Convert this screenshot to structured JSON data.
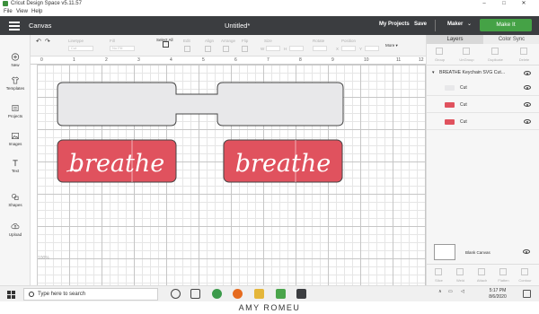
{
  "window": {
    "title": "Cricut Design Space  v5.11.57",
    "controls": [
      "–",
      "□",
      "✕"
    ]
  },
  "menu": [
    "File",
    "View",
    "Help"
  ],
  "header": {
    "section": "Canvas",
    "document_title": "Untitled*",
    "my_projects": "My Projects",
    "save": "Save",
    "machine": "Maker",
    "make_it": "Make It",
    "accent_color": "#45a246"
  },
  "toolbar": {
    "undo_icon": "undo-icon",
    "redo_icon": "redo-icon",
    "linetype_label": "Linetype",
    "linetype_value": "Cut",
    "fill_label": "Fill",
    "fill_value": "No Fill",
    "select_all": "Select All",
    "edit": "Edit",
    "align": "Align",
    "arrange": "Arrange",
    "flip": "Flip",
    "size": "Size",
    "rotate": "Rotate",
    "position": "Position",
    "more": "More ▾",
    "w_label": "W",
    "h_label": "H",
    "x_label": "X",
    "y_label": "Y"
  },
  "leftnav": [
    {
      "label": "New",
      "icon": "plus-icon"
    },
    {
      "label": "Templates",
      "icon": "shirt-icon"
    },
    {
      "label": "Projects",
      "icon": "folder-icon"
    },
    {
      "label": "Images",
      "icon": "image-icon"
    },
    {
      "label": "Text",
      "icon": "text-icon"
    },
    {
      "label": "Shapes",
      "icon": "shapes-icon"
    },
    {
      "label": "Upload",
      "icon": "upload-icon"
    }
  ],
  "ruler": [
    "0",
    "1",
    "2",
    "3",
    "4",
    "5",
    "6",
    "7",
    "8",
    "9",
    "10",
    "11",
    "12"
  ],
  "canvas": {
    "zoom": "100%",
    "design_text": [
      "breathe",
      "breathe"
    ],
    "keychain_color": "#e8e8ea",
    "red_color": "#e0525e"
  },
  "layers_panel": {
    "tabs": [
      "Layers",
      "Color Sync"
    ],
    "top_tools": [
      "Group",
      "UnGroup",
      "Duplicate",
      "Delete"
    ],
    "group_name": "BREATHE Keychain SVG Cut...",
    "layers": [
      {
        "name": "Cut",
        "swatch": "#e8e8ea"
      },
      {
        "name": "Cut",
        "swatch": "#e0525e"
      },
      {
        "name": "Cut",
        "swatch": "#e0525e"
      }
    ],
    "blank_canvas": "Blank Canvas",
    "bottom_tools": [
      "Slice",
      "Weld",
      "Attach",
      "Flatten",
      "Contour"
    ]
  },
  "taskbar": {
    "search_placeholder": "Type here to search",
    "time": "5:17 PM",
    "date": "8/6/2020"
  },
  "watermark": "AMY ROMEU"
}
